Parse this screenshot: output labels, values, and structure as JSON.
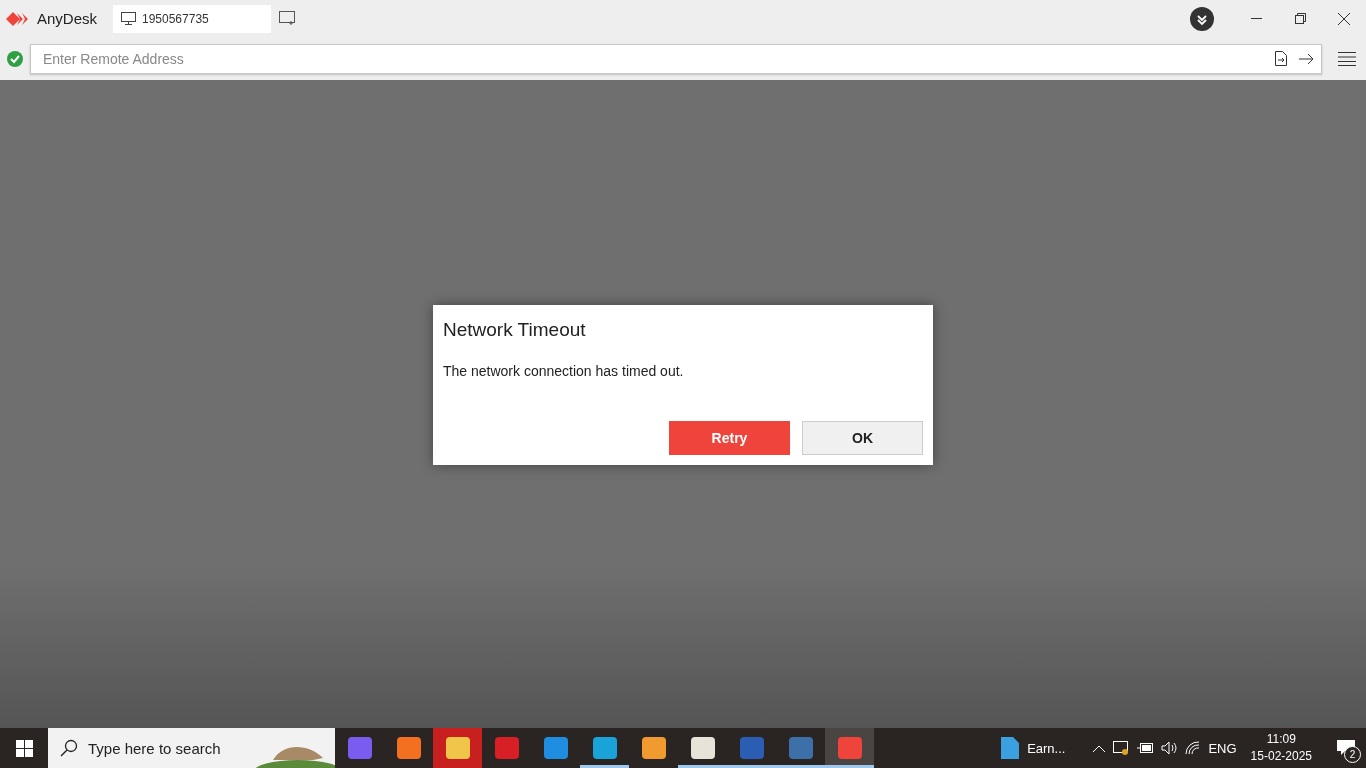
{
  "app": {
    "name": "AnyDesk",
    "address_tab": "1950567735"
  },
  "address_bar": {
    "placeholder": "Enter Remote Address",
    "connected": true
  },
  "dialog": {
    "title": "Network Timeout",
    "message": "The network connection has timed out.",
    "buttons": [
      {
        "label": "Retry",
        "primary": true
      },
      {
        "label": "OK",
        "primary": false
      }
    ]
  },
  "taskbar": {
    "search_placeholder": "Type here to search",
    "apps": [
      {
        "color": "#7b5cf0",
        "running": false,
        "active": false,
        "flashing": false
      },
      {
        "color": "#f2701f",
        "running": false,
        "active": false,
        "flashing": false
      },
      {
        "color": "#f0c64a",
        "running": false,
        "active": false,
        "flashing": true
      },
      {
        "color": "#d81f26",
        "running": false,
        "active": false,
        "flashing": false
      },
      {
        "color": "#1f8ee0",
        "running": false,
        "active": false,
        "flashing": false
      },
      {
        "color": "#1aa3d9",
        "running": true,
        "active": false,
        "flashing": false
      },
      {
        "color": "#f09a30",
        "running": false,
        "active": false,
        "flashing": false
      },
      {
        "color": "#e8e2d8",
        "running": true,
        "active": false,
        "flashing": false
      },
      {
        "color": "#2b5db3",
        "running": true,
        "active": false,
        "flashing": false
      },
      {
        "color": "#3d6fa8",
        "running": true,
        "active": false,
        "flashing": false
      },
      {
        "color": "#ef443b",
        "running": true,
        "active": true,
        "flashing": false
      }
    ],
    "pinned_doc": "Earn...",
    "language": "ENG",
    "time": "11:09",
    "date": "15-02-2025",
    "notifications": "2"
  }
}
